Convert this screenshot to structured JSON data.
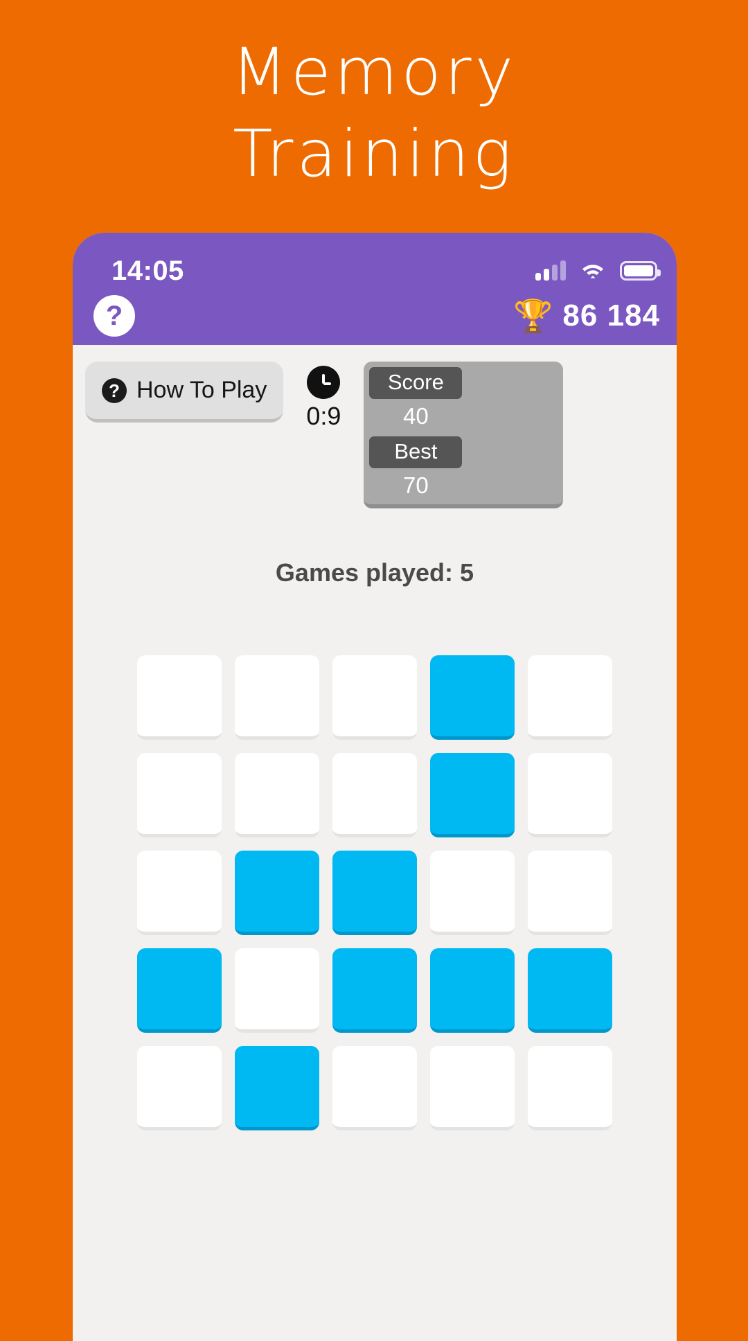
{
  "promo": {
    "title_lines": [
      "Memory",
      "Training"
    ],
    "background_color": "#EE6B02"
  },
  "phone": {
    "status_bar": {
      "time": "14:05",
      "background_color": "#7B57C2",
      "signal_icon": "cellular-signal-icon",
      "signal_bars_filled": 2,
      "signal_bars_total": 4,
      "wifi_icon": "wifi-icon",
      "battery_icon": "battery-full-icon"
    },
    "app_bar": {
      "help_icon": "question-mark-icon",
      "help_label": "?",
      "trophy_icon": "trophy-icon",
      "trophy_glyph": "🏆",
      "total_score": "86 184"
    },
    "toolbar": {
      "how_to_play": {
        "icon": "question-mark-icon",
        "icon_glyph": "?",
        "label": "How To Play"
      },
      "timer": {
        "icon": "clock-icon",
        "value": "0:9"
      },
      "score_panel": {
        "cells": [
          {
            "head": "Score",
            "value": "40"
          },
          {
            "head": "Best",
            "value": "70"
          }
        ]
      }
    },
    "stats": {
      "games_played_label": "Games played: 5"
    },
    "board": {
      "rows": 5,
      "cols": 5,
      "active_color": "#00B9F2",
      "inactive_color": "#FFFFFF",
      "cells": [
        [
          0,
          0,
          0,
          1,
          0
        ],
        [
          0,
          0,
          0,
          1,
          0
        ],
        [
          0,
          1,
          1,
          0,
          0
        ],
        [
          1,
          0,
          1,
          1,
          1
        ],
        [
          0,
          1,
          0,
          0,
          0
        ]
      ]
    }
  }
}
